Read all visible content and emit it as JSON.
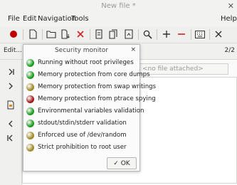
{
  "window": {
    "title": "New file *",
    "close_glyph": "✕"
  },
  "menu": {
    "file": "File",
    "edit": "Edit",
    "navigation": "Navigation",
    "tools": "Tools",
    "help": "Help"
  },
  "tabrow": {
    "edit_label": "Edit...",
    "page_counter": "2/2"
  },
  "attachment_placeholder": "<no file attached>",
  "dialog": {
    "title": "Security monitor",
    "close_glyph": "×",
    "ok_label": "✓ OK",
    "items": [
      {
        "label": "Running without root privileges",
        "status_color": "#1f9a1f"
      },
      {
        "label": "Memory protection from core dumps",
        "status_color": "#1f9a1f"
      },
      {
        "label": "Memory protection from swap writings",
        "status_color": "#a08a2a"
      },
      {
        "label": "Memory protection from ptrace spying",
        "status_color": "#a01818"
      },
      {
        "label": "Environmental variables validation",
        "status_color": "#1f9a1f"
      },
      {
        "label": "stdout/stdin/stderr validation",
        "status_color": "#1f9a1f"
      },
      {
        "label": "Enforced use of /dev/random",
        "status_color": "#a08a2a"
      },
      {
        "label": "Strict prohibition to root user",
        "status_color": "#a08a2a"
      }
    ]
  },
  "toolbar_icons": [
    "record-icon",
    "new-file-icon",
    "open-folder-icon",
    "download-icon",
    "delete-icon",
    "save-icon",
    "save-as-icon",
    "export-icon",
    "search-icon",
    "add-icon",
    "remove-icon",
    "keyboard-icon",
    "close-icon"
  ],
  "colors": {
    "record": "#c00000",
    "delete": "#d52020",
    "remove": "#d52020"
  }
}
